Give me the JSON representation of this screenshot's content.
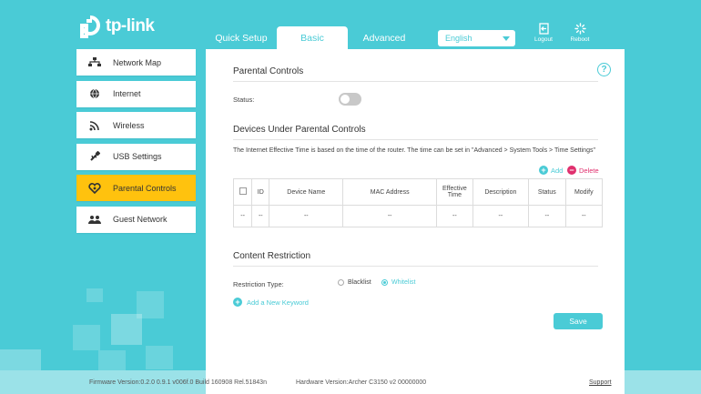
{
  "brand": {
    "logo_text": "tp-link"
  },
  "header": {
    "tabs": [
      {
        "label": "Quick Setup",
        "active": false
      },
      {
        "label": "Basic",
        "active": true
      },
      {
        "label": "Advanced",
        "active": false
      }
    ],
    "language": {
      "value": "English"
    },
    "logout_label": "Logout",
    "reboot_label": "Reboot"
  },
  "sidebar": {
    "items": [
      {
        "label": "Network Map",
        "icon": "network-map-icon",
        "active": false
      },
      {
        "label": "Internet",
        "icon": "globe-icon",
        "active": false
      },
      {
        "label": "Wireless",
        "icon": "wifi-icon",
        "active": false
      },
      {
        "label": "USB Settings",
        "icon": "usb-icon",
        "active": false
      },
      {
        "label": "Parental Controls",
        "icon": "heart-icon",
        "active": true
      },
      {
        "label": "Guest Network",
        "icon": "guest-icon",
        "active": false
      }
    ]
  },
  "main": {
    "parental": {
      "title": "Parental Controls",
      "status_label": "Status:",
      "status_on": false
    },
    "devices": {
      "title": "Devices Under Parental Controls",
      "note": "The Internet Effective Time is based on the time of the router. The time can be set in \"Advanced > System Tools > Time Settings\"",
      "add_label": "Add",
      "delete_label": "Delete",
      "columns": [
        "ID",
        "Device Name",
        "MAC Address",
        "Effective Time",
        "Description",
        "Status",
        "Modify"
      ],
      "rows": [
        [
          "--",
          "--",
          "--",
          "--",
          "--",
          "--",
          "--",
          "--"
        ]
      ]
    },
    "content": {
      "title": "Content Restriction",
      "restriction_label": "Restriction Type:",
      "options": [
        "Blacklist",
        "Whitelist"
      ],
      "selected": "Whitelist",
      "add_keyword_label": "Add a New Keyword"
    },
    "save_label": "Save"
  },
  "footer": {
    "firmware": "Firmware Version:0.2.0 0.9.1 v006f.0 Build 160908 Rel.51843n",
    "hardware": "Hardware Version:Archer C3150 v2 00000000",
    "support": "Support"
  },
  "colors": {
    "accent": "#4acbd6",
    "active_nav": "#ffc20e",
    "delete": "#e0306e"
  }
}
